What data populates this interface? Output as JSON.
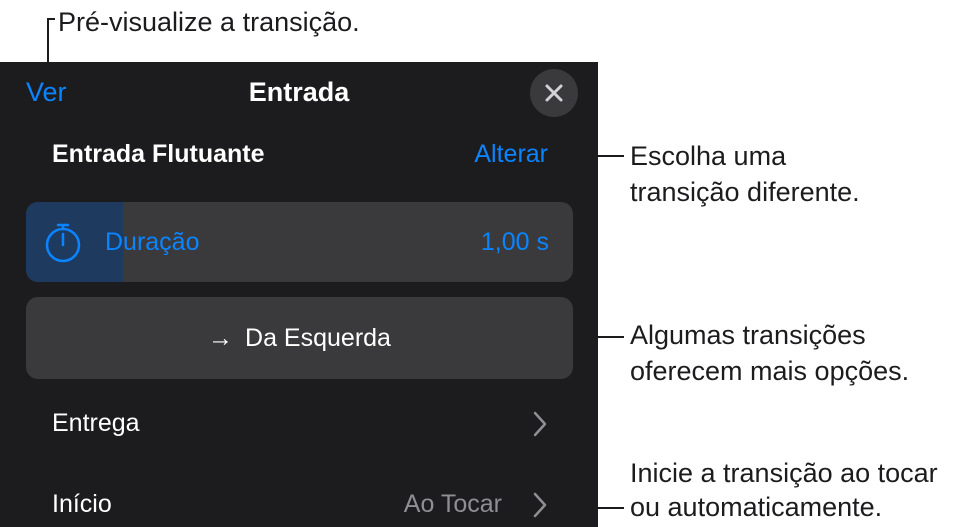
{
  "callouts": {
    "preview": "Pré-visualize a transição.",
    "change_line1": "Escolha uma",
    "change_line2": "transição diferente.",
    "options_line1": "Algumas transições",
    "options_line2": "oferecem mais opções.",
    "start_line1": "Inicie a transição ao tocar",
    "start_line2": "ou automaticamente."
  },
  "header": {
    "view_label": "Ver",
    "title": "Entrada"
  },
  "effect": {
    "name": "Entrada Flutuante",
    "change_label": "Alterar"
  },
  "duration": {
    "label": "Duração",
    "value": "1,00 s"
  },
  "direction": {
    "arrow": "→",
    "label": "Da Esquerda"
  },
  "rows": {
    "delivery_label": "Entrega",
    "start_label": "Início",
    "start_value": "Ao Tocar"
  },
  "colors": {
    "accent": "#0a84ff",
    "panel_bg": "#1c1c1e",
    "control_bg": "#3a3a3c"
  }
}
